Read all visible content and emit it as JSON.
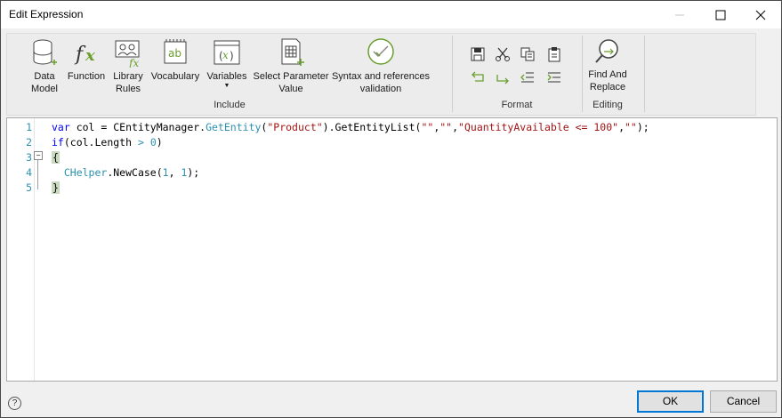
{
  "window": {
    "title": "Edit Expression"
  },
  "ribbon": {
    "include": {
      "group_label": "Include",
      "data_model_label": "Data\nModel",
      "function_label": "Function",
      "library_rules_label": "Library\nRules",
      "vocabulary_label": "Vocabulary",
      "variables_label": "Variables",
      "select_param_label": "Select Parameter\nValue",
      "syntax_label": "Syntax and references\nvalidation"
    },
    "format": {
      "group_label": "Format"
    },
    "editing": {
      "group_label": "Editing",
      "find_replace_label": "Find And\nReplace"
    }
  },
  "editor": {
    "line_numbers": [
      "1",
      "2",
      "3",
      "4",
      "5"
    ],
    "lines": [
      [
        {
          "t": "var ",
          "c": "kw"
        },
        {
          "t": "col = CEntityManager.",
          "c": "pl"
        },
        {
          "t": "GetEntity",
          "c": "mth"
        },
        {
          "t": "(",
          "c": "pl"
        },
        {
          "t": "\"Product\"",
          "c": "str"
        },
        {
          "t": ").GetEntityList(",
          "c": "pl"
        },
        {
          "t": "\"\"",
          "c": "str"
        },
        {
          "t": ",",
          "c": "pl"
        },
        {
          "t": "\"\"",
          "c": "str"
        },
        {
          "t": ",",
          "c": "pl"
        },
        {
          "t": "\"QuantityAvailable <= 100\"",
          "c": "str"
        },
        {
          "t": ",",
          "c": "pl"
        },
        {
          "t": "\"\"",
          "c": "str"
        },
        {
          "t": ");",
          "c": "pl"
        }
      ],
      [
        {
          "t": "if",
          "c": "kw"
        },
        {
          "t": "(col.Length ",
          "c": "pl"
        },
        {
          "t": ">",
          "c": "mth"
        },
        {
          "t": " ",
          "c": "pl"
        },
        {
          "t": "0",
          "c": "mth"
        },
        {
          "t": ")",
          "c": "pl"
        }
      ],
      [
        {
          "t": "{",
          "c": "brace"
        }
      ],
      [
        {
          "t": "  ",
          "c": "pl"
        },
        {
          "t": "CHelper",
          "c": "mth"
        },
        {
          "t": ".NewCase(",
          "c": "pl"
        },
        {
          "t": "1",
          "c": "mth"
        },
        {
          "t": ", ",
          "c": "pl"
        },
        {
          "t": "1",
          "c": "mth"
        },
        {
          "t": ");",
          "c": "pl"
        }
      ],
      [
        {
          "t": "}",
          "c": "brace"
        }
      ]
    ]
  },
  "footer": {
    "help_label": "?",
    "ok_label": "OK",
    "cancel_label": "Cancel"
  },
  "colors": {
    "accent": "#0078d7",
    "keyword": "#0000ff",
    "string": "#a31515",
    "method": "#2b91af",
    "icon_green": "#6a9e2e"
  }
}
